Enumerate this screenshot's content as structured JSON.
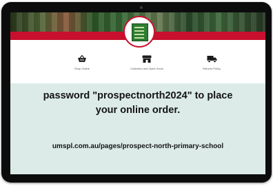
{
  "icons": [
    {
      "label": "Shop Online",
      "icon": "basket-icon"
    },
    {
      "label": "Collection and Open Hours",
      "icon": "store-icon"
    },
    {
      "label": "Returns Policy",
      "icon": "truck-icon"
    }
  ],
  "message": {
    "line1": "password \"prospectnorth2024\" to place",
    "line2": "your online  order."
  },
  "url": "umspl.com.au/pages/prospect-north-primary-school",
  "colors": {
    "accent": "#c8102e",
    "panel": "#dcebe8",
    "bezel": "#0c0c0d"
  }
}
